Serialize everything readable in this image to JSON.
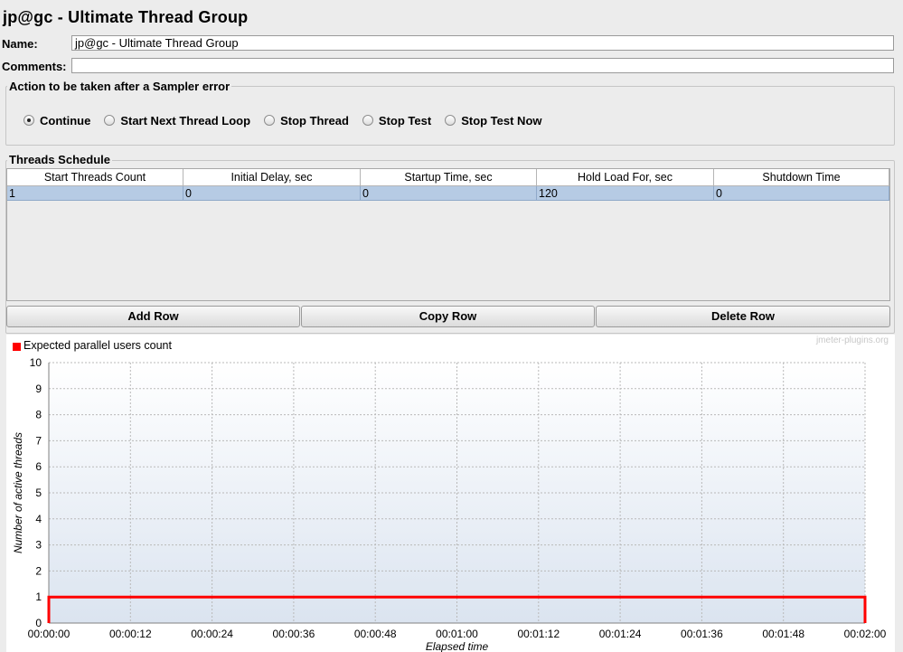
{
  "window": {
    "title": "jp@gc - Ultimate Thread Group"
  },
  "form": {
    "name_label": "Name:",
    "name_value": "jp@gc - Ultimate Thread Group",
    "comments_label": "Comments:",
    "comments_value": ""
  },
  "sampler_error": {
    "legend": "Action to be taken after a Sampler error",
    "options": [
      "Continue",
      "Start Next Thread Loop",
      "Stop Thread",
      "Stop Test",
      "Stop Test Now"
    ],
    "selected": "Continue"
  },
  "schedule": {
    "legend": "Threads Schedule",
    "columns": [
      "Start Threads Count",
      "Initial Delay, sec",
      "Startup Time, sec",
      "Hold Load For, sec",
      "Shutdown Time"
    ],
    "rows": [
      [
        "1",
        "0",
        "0",
        "120",
        "0"
      ]
    ]
  },
  "buttons": {
    "add": "Add Row",
    "copy": "Copy Row",
    "delete": "Delete Row"
  },
  "chart_panel": {
    "legend_label": "Expected parallel users count",
    "watermark": "jmeter-plugins.org"
  },
  "chart_data": {
    "type": "line",
    "xlabel": "Elapsed time",
    "ylabel": "Number of active threads",
    "xlim": [
      0,
      120
    ],
    "ylim": [
      0,
      10
    ],
    "x_tick_values": [
      0,
      12,
      24,
      36,
      48,
      60,
      72,
      84,
      96,
      108,
      120
    ],
    "x_ticks": [
      "00:00:00",
      "00:00:12",
      "00:00:24",
      "00:00:36",
      "00:00:48",
      "00:01:00",
      "00:01:12",
      "00:01:24",
      "00:01:36",
      "00:01:48",
      "00:02:00"
    ],
    "y_ticks": [
      "0",
      "1",
      "2",
      "3",
      "4",
      "5",
      "6",
      "7",
      "8",
      "9",
      "10"
    ],
    "series": [
      {
        "name": "Expected parallel users count",
        "color": "#ff0000",
        "x": [
          0,
          0,
          120,
          120
        ],
        "y": [
          0,
          1,
          1,
          0
        ]
      }
    ],
    "grid": true
  }
}
